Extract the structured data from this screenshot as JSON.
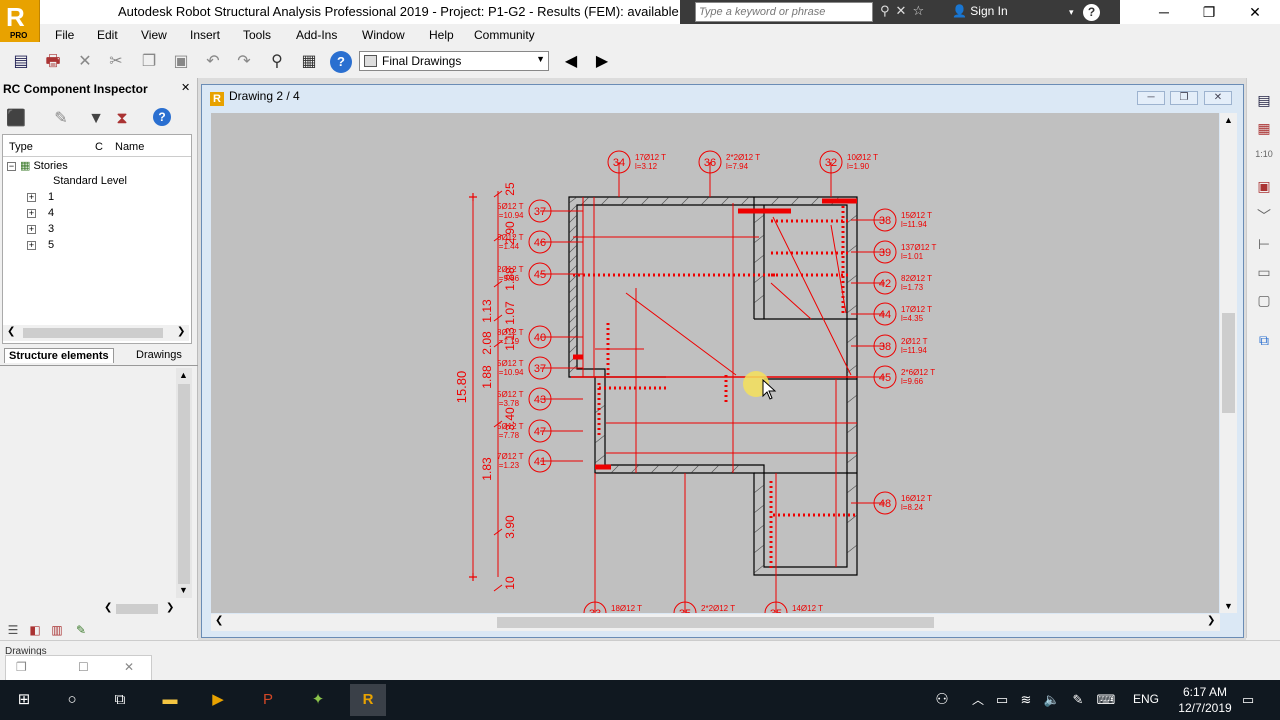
{
  "window": {
    "title": "Autodesk Robot Structural Analysis Professional 2019 - Project: P1-G2 - Results (FEM): available",
    "logo_letter": "R",
    "logo_badge": "PRO",
    "search_placeholder": "Type a keyword or phrase",
    "sign_in": "Sign In",
    "help": "?"
  },
  "menu": [
    "File",
    "Edit",
    "View",
    "Insert",
    "Tools",
    "Add-Ins",
    "Window",
    "Help",
    "Community"
  ],
  "toolbar": {
    "view_combo": "Final Drawings"
  },
  "inspector": {
    "title": "RC Component Inspector",
    "columns": [
      "Type",
      "C",
      "Name"
    ],
    "tree_root": "Stories",
    "tree_items": [
      "Standard Level",
      "1",
      "4",
      "3",
      "5"
    ],
    "tabs": [
      "Structure elements",
      "Drawings"
    ]
  },
  "drawing_window": {
    "title": "Drawing 2 / 4"
  },
  "drawing": {
    "top_marks": [
      {
        "num": "34",
        "line1": "17Ø12 T",
        "line2": "l=3.12"
      },
      {
        "num": "36",
        "line1": "2*2Ø12 T",
        "line2": "l=7.94"
      },
      {
        "num": "32",
        "line1": "10Ø12 T",
        "line2": "l=1.90"
      }
    ],
    "left_marks": [
      {
        "num": "37",
        "line1": "5Ø12 T",
        "line2": "l=10.94"
      },
      {
        "num": "46",
        "line1": "3Ø12 T",
        "line2": "l=1.44"
      },
      {
        "num": "45",
        "line1": "2Ø12 T",
        "line2": "l=9.66"
      },
      {
        "num": "40",
        "line1": "8Ø12 T",
        "line2": "l=1.19"
      },
      {
        "num": "37",
        "line1": "5Ø12 T",
        "line2": "l=10.94"
      },
      {
        "num": "43",
        "line1": "5Ø12 T",
        "line2": "l=3.78"
      },
      {
        "num": "47",
        "line1": "5Ø12 T",
        "line2": "l=7.78"
      },
      {
        "num": "41",
        "line1": "7Ø12 T",
        "line2": "l=1.23"
      }
    ],
    "right_marks": [
      {
        "num": "38",
        "line1": "15Ø12 T",
        "line2": "l=11.94"
      },
      {
        "num": "39",
        "line1": "137Ø12 T",
        "line2": "l=1.01"
      },
      {
        "num": "42",
        "line1": "82Ø12 T",
        "line2": "l=1.73"
      },
      {
        "num": "44",
        "line1": "17Ø12 T",
        "line2": "l=4.35"
      },
      {
        "num": "38",
        "line1": "2Ø12 T",
        "line2": "l=11.94"
      },
      {
        "num": "45",
        "line1": "2*6Ø12 T",
        "line2": "l=9.66"
      },
      {
        "num": "48",
        "line1": "16Ø12 T",
        "line2": "l=8.24"
      }
    ],
    "bottom_marks": [
      {
        "num": "33",
        "line1": "18Ø12 T"
      },
      {
        "num": "35",
        "line1": "2*2Ø12 T"
      },
      {
        "num": "35",
        "line1": "14Ø12 T"
      }
    ],
    "dims_outer": [
      "25",
      "2.90",
      "1.88",
      "1.07",
      "1.13",
      "3.40",
      "3.90",
      "10"
    ],
    "dims_total": "15.80",
    "dims_inner": [
      "2.08",
      "1.13",
      "1.88",
      "1.83"
    ]
  },
  "taskbar": {
    "lang": "ENG",
    "time": "6:17 AM",
    "date": "12/7/2019"
  },
  "status": {
    "text": "Drawings"
  },
  "colors": {
    "accent": "#e8a200",
    "drawing_red": "#ee0000",
    "canvas_bg": "#c0c0c0",
    "taskbar_bg": "#101820"
  }
}
